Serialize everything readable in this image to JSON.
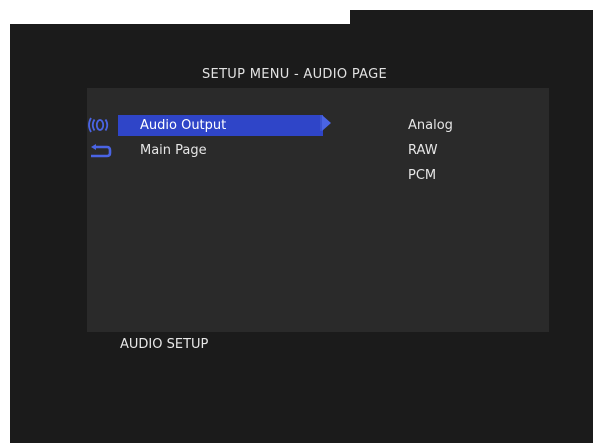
{
  "title": "SETUP MENU - AUDIO PAGE",
  "menu": {
    "items": [
      {
        "label": "Audio Output",
        "icon": "speaker-icon",
        "selected": true
      },
      {
        "label": "Main Page",
        "icon": "return-arrow-icon",
        "selected": false
      }
    ]
  },
  "options": [
    "Analog",
    "RAW",
    "PCM"
  ],
  "footer": "AUDIO SETUP",
  "colors": {
    "background": "#1b1b1b",
    "panel": "#2a2a2a",
    "highlight": "#2f45c8",
    "icon": "#4a64e4",
    "text": "#e6e6e6"
  }
}
